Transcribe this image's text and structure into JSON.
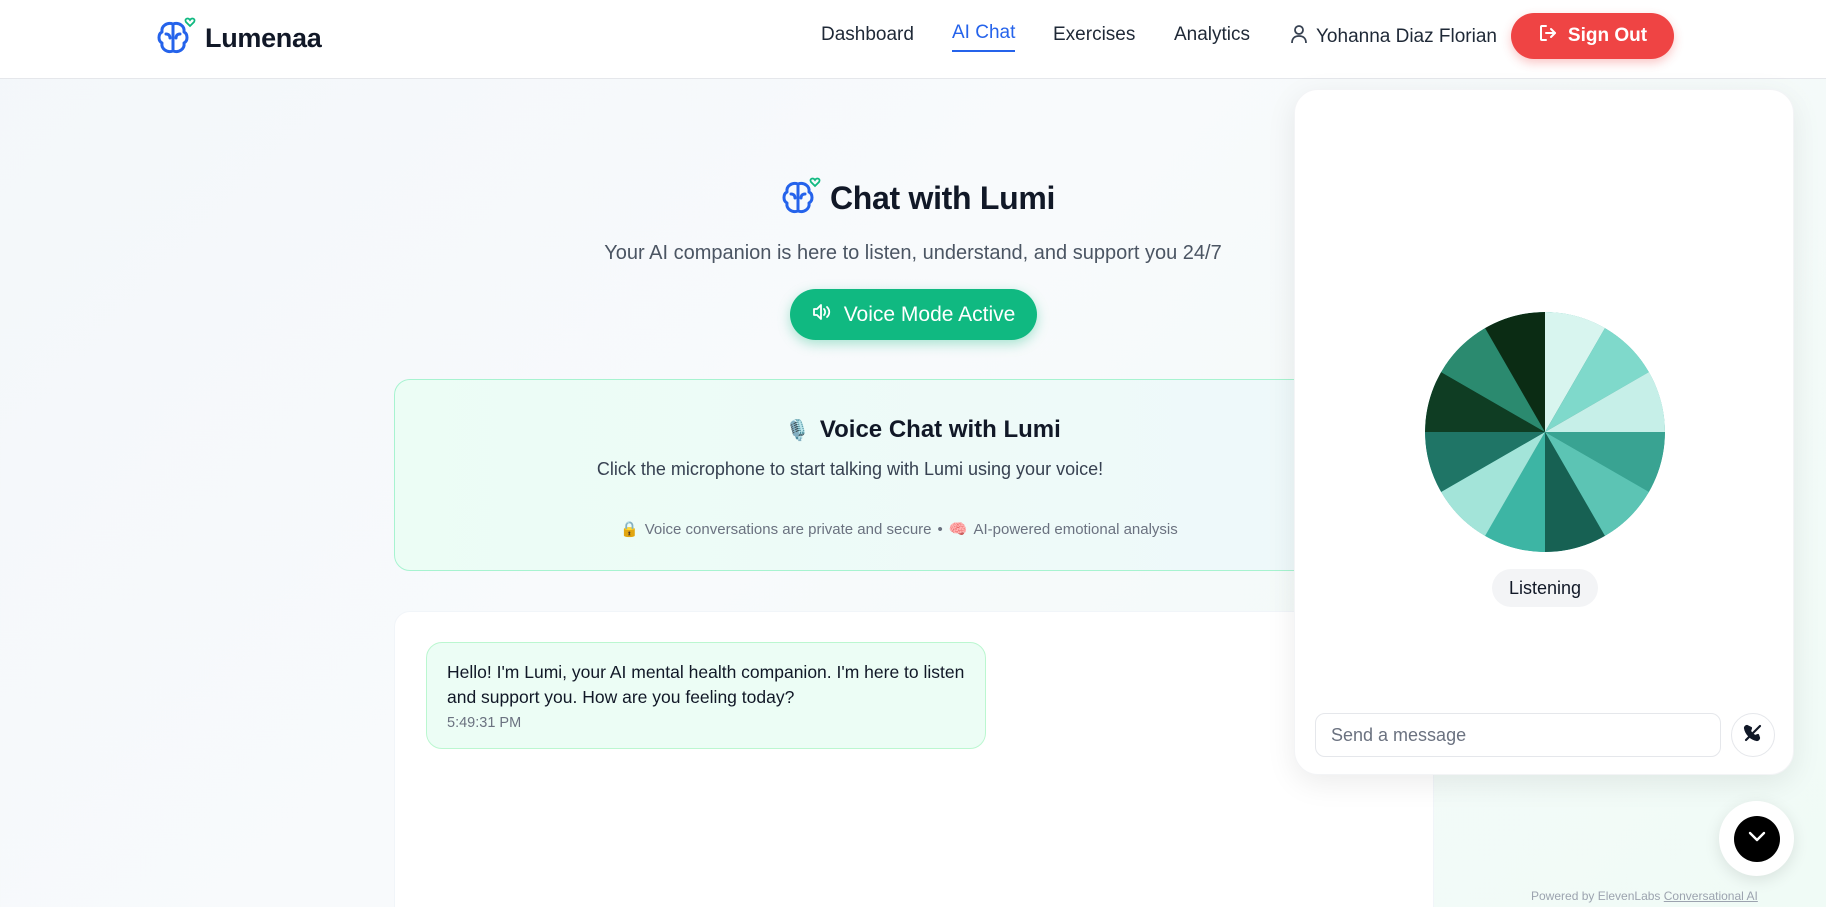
{
  "header": {
    "brand": "Lumenaa",
    "nav": [
      "Dashboard",
      "AI Chat",
      "Exercises",
      "Analytics"
    ],
    "active_nav": "AI Chat",
    "user_name": "Yohanna Diaz Florian",
    "signout_label": "Sign Out"
  },
  "hero": {
    "title": "Chat with Lumi",
    "subtitle": "Your AI companion is here to listen, understand, and support you 24/7",
    "voice_button": "Voice Mode Active"
  },
  "voice_card": {
    "emoji": "🎙️",
    "title": "Voice Chat with Lumi",
    "description": "Click the microphone to start talking with Lumi using your voice!",
    "note_private_emoji": "🔒",
    "note_private": "Voice conversations are private and secure",
    "note_separator": "•",
    "note_ai_emoji": "🧠",
    "note_ai": "AI-powered emotional analysis"
  },
  "chat": {
    "messages": [
      {
        "text": "Hello! I'm Lumi, your AI mental health companion. I'm here to listen and support you. How are you feeling today?",
        "time": "5:49:31 PM"
      }
    ]
  },
  "widget": {
    "status": "Listening",
    "input_placeholder": "Send a message",
    "powered_prefix": "Powered by ElevenLabs",
    "powered_link": "Conversational AI"
  },
  "icons": {
    "brand": "brain-heart-icon",
    "user": "user-icon",
    "signout": "logout-icon",
    "voice": "speaker-icon",
    "end_call": "phone-off-icon",
    "fab": "chevron-down-icon"
  },
  "colors": {
    "accent_blue": "#2563eb",
    "accent_green": "#10b981",
    "danger": "#ef4444"
  }
}
